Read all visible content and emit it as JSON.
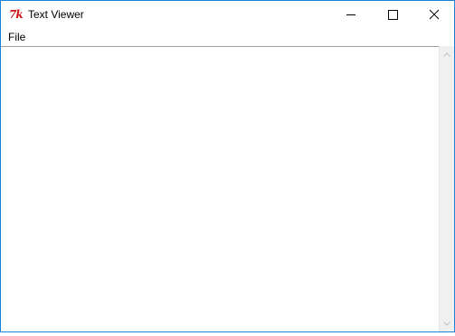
{
  "window": {
    "title": "Text Viewer",
    "app_icon_text": "7k",
    "accent_color": "#1883d7"
  },
  "caption_buttons": {
    "minimize_icon": "minimize-icon",
    "maximize_icon": "maximize-icon",
    "close_icon": "close-icon"
  },
  "menu": {
    "items": [
      {
        "label": "File"
      }
    ]
  },
  "editor": {
    "content": ""
  },
  "scrollbar": {
    "up_icon": "chevron-up-icon",
    "down_icon": "chevron-down-icon"
  }
}
